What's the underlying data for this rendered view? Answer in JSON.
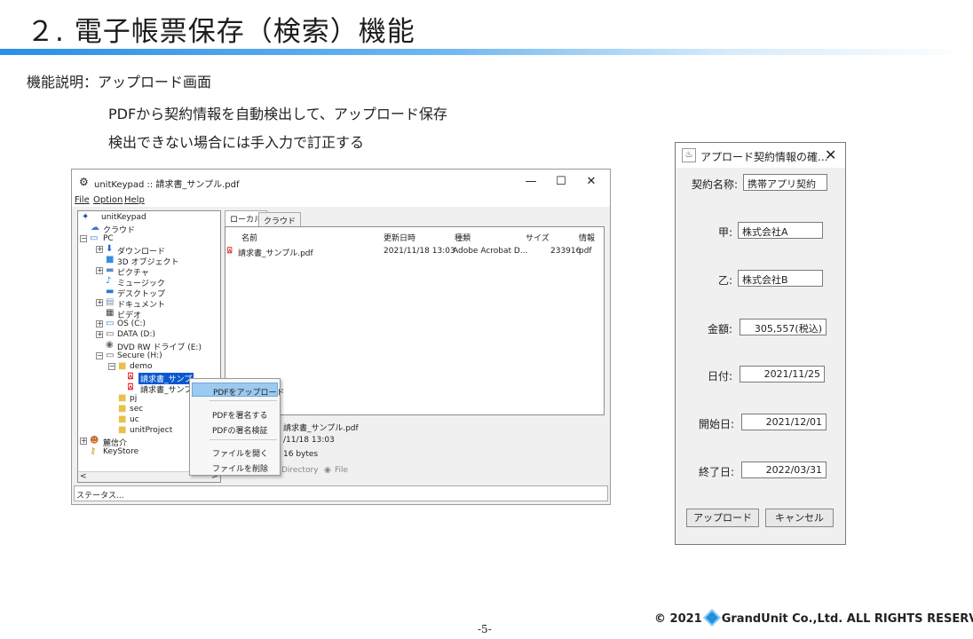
{
  "slide": {
    "title": "２. 電子帳票保存（検索）機能",
    "desc1": "機能説明：アップロード画面",
    "desc2": "PDFから契約情報を自動検出して、アップロード保存",
    "desc3": "検出できない場合には手入力で訂正する",
    "page_number": "-5-",
    "copyright_pre": "© 2021",
    "copyright_post": "GrandUnit Co.,Ltd. ALL RIGHTS RESERVED"
  },
  "app": {
    "title": "unitKeypad :: 請求書_サンプル.pdf",
    "minimize": "—",
    "maximize": "☐",
    "close": "✕",
    "menu": [
      "File",
      "Option",
      "Help"
    ],
    "tree": [
      {
        "label": "unitKeypad",
        "icon": "app-icon"
      },
      {
        "label": "クラウド",
        "icon": "cloud-icon"
      },
      {
        "label": "PC",
        "icon": "pc-icon"
      },
      {
        "label": "ダウンロード",
        "icon": "download-icon"
      },
      {
        "label": "3D オブジェクト",
        "icon": "cube-icon"
      },
      {
        "label": "ピクチャ",
        "icon": "picture-icon"
      },
      {
        "label": "ミュージック",
        "icon": "music-icon"
      },
      {
        "label": "デスクトップ",
        "icon": "desktop-icon"
      },
      {
        "label": "ドキュメント",
        "icon": "document-icon"
      },
      {
        "label": "ビデオ",
        "icon": "video-icon"
      },
      {
        "label": "OS (C:)",
        "icon": "drive-icon"
      },
      {
        "label": "DATA (D:)",
        "icon": "drive-icon"
      },
      {
        "label": "DVD RW ドライブ (E:)",
        "icon": "dvd-icon"
      },
      {
        "label": "Secure (H:)",
        "icon": "drive-icon"
      },
      {
        "label": "demo",
        "icon": "folder-icon"
      },
      {
        "label": "請求書_サンプ",
        "icon": "pdf-icon"
      },
      {
        "label": "請求書_サンプ",
        "icon": "pdf-icon"
      },
      {
        "label": "pj",
        "icon": "folder-icon"
      },
      {
        "label": "sec",
        "icon": "folder-icon"
      },
      {
        "label": "uc",
        "icon": "folder-icon"
      },
      {
        "label": "unitProject",
        "icon": "folder-icon"
      },
      {
        "label": "麓信介",
        "icon": "user-icon"
      },
      {
        "label": "KeyStore",
        "icon": "key-icon"
      }
    ],
    "tabs": [
      "ローカル",
      "クラウド"
    ],
    "columns": [
      "名前",
      "更新日時",
      "種類",
      "サイズ",
      "情報"
    ],
    "file": {
      "name": "請求書_サンプル.pdf",
      "modified": "2021/11/18 13:03",
      "type": "Adobe Acrobat D...",
      "size": "233916",
      "info": "pdf"
    },
    "detail": {
      "name": "請求書_サンプル.pdf",
      "date": "/11/18 13:03",
      "bytes": "16 bytes",
      "radio_dir": "Directory",
      "radio_file": "File"
    },
    "status": "ステータス..."
  },
  "context_menu": {
    "items": [
      "PDFをアップロード",
      "PDFを署名する",
      "PDFの署名検証",
      "ファイルを開く",
      "ファイルを削除"
    ]
  },
  "dialog": {
    "title": "アプロード契約情報の確...",
    "close": "✕",
    "contract_name_label": "契約名称:",
    "contract_name": "携帯アプリ契約",
    "party_a_label": "甲:",
    "party_a": "株式会社A",
    "party_b_label": "乙:",
    "party_b": "株式会社B",
    "amount_label": "金額:",
    "amount": "305,557(税込)",
    "date_label": "日付:",
    "date": "2021/11/25",
    "start_label": "開始日:",
    "start": "2021/12/01",
    "end_label": "終了日:",
    "end": "2022/03/31",
    "upload_button": "アップロード",
    "cancel_button": "キャンセル"
  }
}
